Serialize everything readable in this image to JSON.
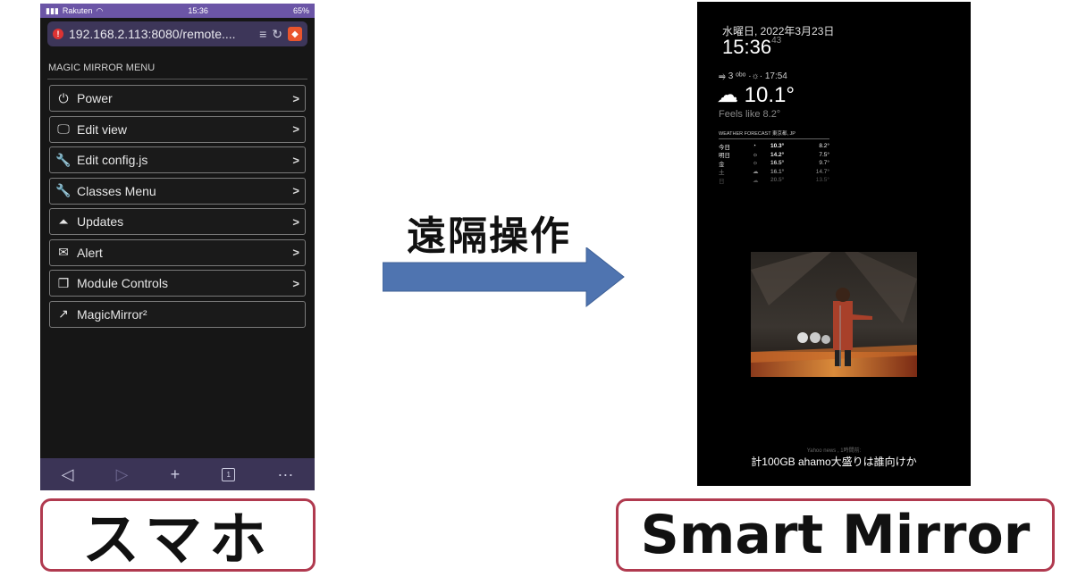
{
  "phone": {
    "status": {
      "carrier": "Rakuten",
      "time": "15:36",
      "battery": "65%"
    },
    "url": "192.168.2.113:8080/remote....",
    "menu_title": "MAGIC MIRROR MENU",
    "menu_items": [
      {
        "label": "Power",
        "icon": "power-icon",
        "glyph": "⏻",
        "chevron": ">"
      },
      {
        "label": "Edit view",
        "icon": "monitor-icon",
        "glyph": "🖵",
        "chevron": ">"
      },
      {
        "label": "Edit config.js",
        "icon": "wrench-icon",
        "glyph": "🔧",
        "chevron": ">"
      },
      {
        "label": "Classes Menu",
        "icon": "wrench-icon",
        "glyph": "🔧",
        "chevron": ">"
      },
      {
        "label": "Updates",
        "icon": "update-box-icon",
        "glyph": "⏶",
        "chevron": ">"
      },
      {
        "label": "Alert",
        "icon": "envelope-icon",
        "glyph": "✉",
        "chevron": ">"
      },
      {
        "label": "Module Controls",
        "icon": "windows-icon",
        "glyph": "❐",
        "chevron": ">"
      },
      {
        "label": "MagicMirror²",
        "icon": "external-link-icon",
        "glyph": "↗",
        "chevron": ""
      }
    ],
    "bottom_bar": {
      "back": "◁",
      "forward": "▷",
      "add": "+",
      "tabs": "1",
      "more": "···"
    }
  },
  "labels": {
    "phone": "スマホ",
    "remote": "遠隔操作",
    "mirror": "Smart Mirror"
  },
  "mirror": {
    "date": "水曜日, 2022年3月23日",
    "time": "15:36",
    "seconds": "43",
    "wind_sun": "⥤ 3 ᵒᵇᵒ ·☼· 17:54",
    "temperature": "10.1°",
    "weather_icon": "☁",
    "feels_like": "Feels like 8.2°",
    "forecast_header": "WEATHER FORECAST 東京都, JP",
    "forecast": [
      {
        "day": "今日",
        "icon": "◔",
        "high": "10.3°",
        "low": "8.2°"
      },
      {
        "day": "明日",
        "icon": "☼",
        "high": "14.2°",
        "low": "7.5°"
      },
      {
        "day": "金",
        "icon": "☼",
        "high": "16.5°",
        "low": "9.7°"
      },
      {
        "day": "土",
        "icon": "☁",
        "high": "16.1°",
        "low": "14.7°"
      },
      {
        "day": "日",
        "icon": "☁",
        "high": "20.5°",
        "low": "13.5°"
      }
    ],
    "news_source": "Yahoo news , 1時間前:",
    "news_headline": "計100GB ahamo大盛りは誰向けか"
  },
  "colors": {
    "phone_bar": "#3b3456",
    "label_border": "#b03a4f",
    "arrow": "#4f74b0"
  }
}
